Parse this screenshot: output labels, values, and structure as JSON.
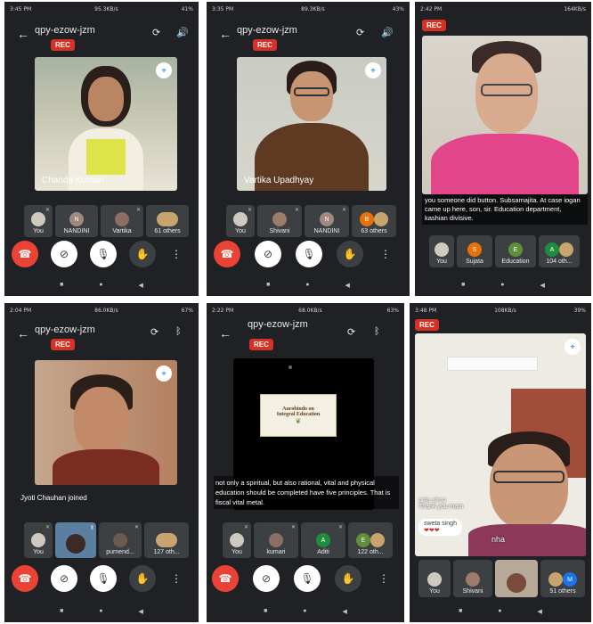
{
  "meeting_code": "qpy-ezow-jzm",
  "rec": "REC",
  "screens": [
    {
      "time": "3:45 PM",
      "net": "95.3KB/s",
      "battery": "41%",
      "speaker": "Chanda Kumari",
      "tiles": [
        "You",
        "NANDINI",
        "Vartika",
        "61 others"
      ],
      "nandini_letter": "N"
    },
    {
      "time": "3:35 PM",
      "net": "89.3KB/s",
      "battery": "43%",
      "speaker": "Vartika Upadhyay",
      "tiles": [
        "You",
        "Shivani",
        "NANDINI",
        "63 others"
      ],
      "nandini_letter": "N",
      "badge_letter": "B"
    },
    {
      "time": "2:42 PM",
      "net": "164KB/s",
      "caption": "you someone did button. Subsamajita. At case iogan came up here, son, sir. Education department, kashian divisive.",
      "tiles": [
        "You",
        "Sujata",
        "Education",
        "104 oth..."
      ],
      "letters": [
        "S",
        "E",
        "A"
      ]
    },
    {
      "time": "2:04 PM",
      "net": "86.0KB/s",
      "battery": "67%",
      "joined": "Jyoti Chauhan joined",
      "tiles": [
        "You",
        "",
        "purnend...",
        "127 oth..."
      ]
    },
    {
      "time": "2:22 PM",
      "net": "68.0KB/s",
      "battery": "63%",
      "slide_line1": "Aurobindo on",
      "slide_line2": "Integral Education",
      "caption": "not only a spiritual, but also rational, vital and physical education should be completed have five principles.  That is fiscal vital metal.",
      "tiles": [
        "You",
        "kumari",
        "Aditi",
        "122 oth..."
      ],
      "letters": [
        "A",
        "E"
      ]
    },
    {
      "time": "3:48 PM",
      "net": "108KB/s",
      "battery": "39%",
      "chat1_name": "nida afroz",
      "chat1_msg": "Thank you mam",
      "chat2_name": "sweta singh",
      "chat2_msg": "❤❤❤",
      "partial_name": "nha",
      "tiles": [
        "You",
        "Shivani",
        "",
        "51 others"
      ],
      "letter": "M"
    }
  ],
  "colors": {
    "panel": "#202124",
    "tile": "#3c4043",
    "end": "#ea4335",
    "rec": "#d93025",
    "pin": "#1a73e8"
  }
}
